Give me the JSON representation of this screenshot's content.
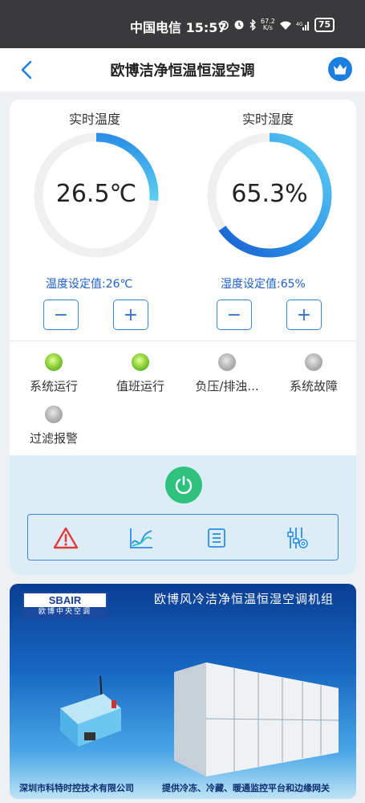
{
  "status_bar": {
    "carrier_time": "中国电信 15:57",
    "net_speed_value": "67.2",
    "net_speed_unit": "K/s",
    "battery": "75"
  },
  "nav": {
    "title": "欧博洁净恒温恒湿空调"
  },
  "temperature": {
    "label": "实时温度",
    "value": "26.5℃",
    "setpoint_text": "温度设定值:26℃",
    "arc_fraction": 0.265
  },
  "humidity": {
    "label": "实时湿度",
    "value": "65.3%",
    "setpoint_text": "湿度设定值:65%",
    "arc_fraction": 0.653
  },
  "stepper": {
    "minus": "−",
    "plus": "+"
  },
  "status_items": [
    {
      "label": "系统运行",
      "state": "on"
    },
    {
      "label": "值班运行",
      "state": "on"
    },
    {
      "label": "负压/排浊...",
      "state": "off"
    },
    {
      "label": "系统故障",
      "state": "off"
    },
    {
      "label": "过滤报警",
      "state": "off"
    }
  ],
  "toolbar": {
    "icons": [
      "alarm-icon",
      "trend-chart-icon",
      "list-icon",
      "settings-sliders-icon"
    ]
  },
  "banner": {
    "logo_text": "SBAIR",
    "logo_subtext": "欧博中央空调",
    "headline": "欧博风冷洁净恒温恒湿空调机组",
    "footer_left": "深圳市科特时控技术有限公司",
    "footer_right": "提供冷冻、冷藏、暖通监控平台和边缘网关"
  },
  "colors": {
    "accent": "#1b7ee0",
    "power_green": "#2ec27e",
    "alarm_red": "#e23b3b",
    "led_on": "#8ed33a",
    "led_off": "#b5b5b5",
    "control_bg": "#dcedf8"
  }
}
